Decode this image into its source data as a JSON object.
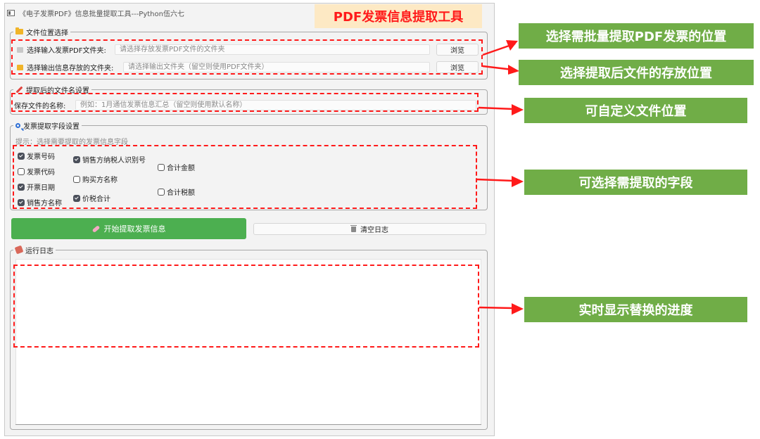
{
  "window": {
    "title": "《电子发票PDF》信息批量提取工具---Python伍六七"
  },
  "banner": {
    "text": "PDF发票信息提取工具",
    "color": "#ff1a1a"
  },
  "file_location": {
    "legend": "文件位置选择",
    "input_row": {
      "label": "选择输入发票PDF文件夹:",
      "placeholder": "请选择存放发票PDF文件的文件夹",
      "browse": "浏览"
    },
    "output_row": {
      "label": "选择输出信息存放的文件夹:",
      "placeholder": "请选择输出文件夹（留空则使用PDF文件夹）",
      "browse": "浏览"
    }
  },
  "filename": {
    "legend": "提取后的文件名设置",
    "label": "保存文件的名称:",
    "placeholder": "例如：1月通信发票信息汇总（留空则使用默认名称）"
  },
  "fields": {
    "legend": "发票提取字段设置",
    "hint": "提示：选择需要提取的发票信息字段",
    "items": [
      {
        "label": "发票号码",
        "checked": true
      },
      {
        "label": "发票代码",
        "checked": false
      },
      {
        "label": "开票日期",
        "checked": true
      },
      {
        "label": "销售方名称",
        "checked": true
      },
      {
        "label": "销售方纳税人识别号",
        "checked": true
      },
      {
        "label": "购买方名称",
        "checked": false
      },
      {
        "label": "价税合计",
        "checked": true
      },
      {
        "label": "合计金额",
        "checked": false
      },
      {
        "label": "合计税额",
        "checked": false
      }
    ]
  },
  "actions": {
    "start": "开始提取发票信息",
    "start_color": "#4caf50",
    "clear": "清空日志"
  },
  "log": {
    "legend": "运行日志"
  },
  "annotations": {
    "color": "#70ad47",
    "labels": [
      "选择需批量提取PDF发票的位置",
      "选择提取后文件的存放位置",
      "可自定义文件位置",
      "可选择需提取的字段",
      "实时显示替换的进度"
    ]
  }
}
